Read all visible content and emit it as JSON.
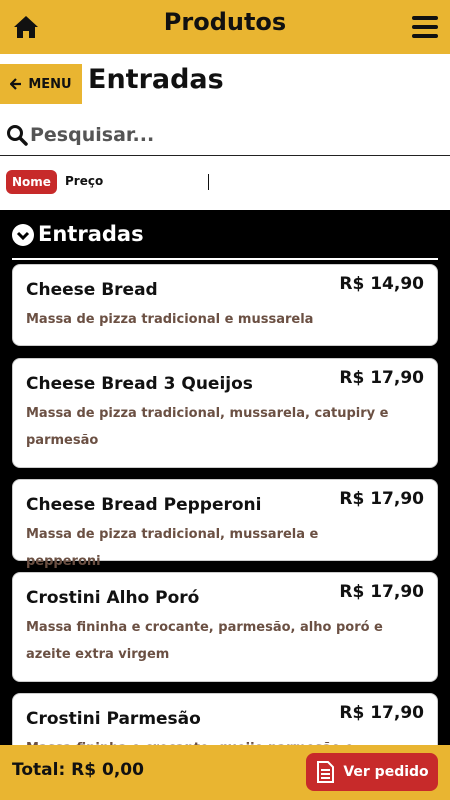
{
  "app": {
    "title": "Produtos"
  },
  "nav": {
    "back_label": "MENU",
    "page_title": "Entradas"
  },
  "search": {
    "placeholder": "Pesquisar..."
  },
  "sort": {
    "options": [
      "Nome",
      "Preço"
    ],
    "active": "Nome"
  },
  "section": {
    "title": "Entradas"
  },
  "products": [
    {
      "name": "Cheese Bread",
      "price": "R$ 14,90",
      "desc": "Massa de pizza tradicional e mussarela"
    },
    {
      "name": "Cheese Bread 3 Queijos",
      "price": "R$ 17,90",
      "desc": "Massa de pizza tradicional, mussarela, catupiry e parmesão"
    },
    {
      "name": "Cheese Bread Pepperoni",
      "price": "R$ 17,90",
      "desc": "Massa de pizza tradicional, mussarela e pepperoni"
    },
    {
      "name": "Crostini Alho Poró",
      "price": "R$ 17,90",
      "desc": "Massa fininha e crocante, parmesão, alho poró e azeite extra virgem"
    },
    {
      "name": "Crostini Parmesão",
      "price": "R$ 17,90",
      "desc": "Massa fininha e crocante, queijo parmesão e azeite"
    }
  ],
  "footer": {
    "total": "Total: R$ 0,00",
    "order_button": "Ver pedido"
  },
  "colors": {
    "accent": "#e9b531",
    "primary": "#c72a2a",
    "desc": "#6b5043"
  },
  "icons": [
    "home-icon",
    "hamburger-icon",
    "arrow-left-icon",
    "search-icon",
    "chevron-down-icon",
    "receipt-icon"
  ]
}
